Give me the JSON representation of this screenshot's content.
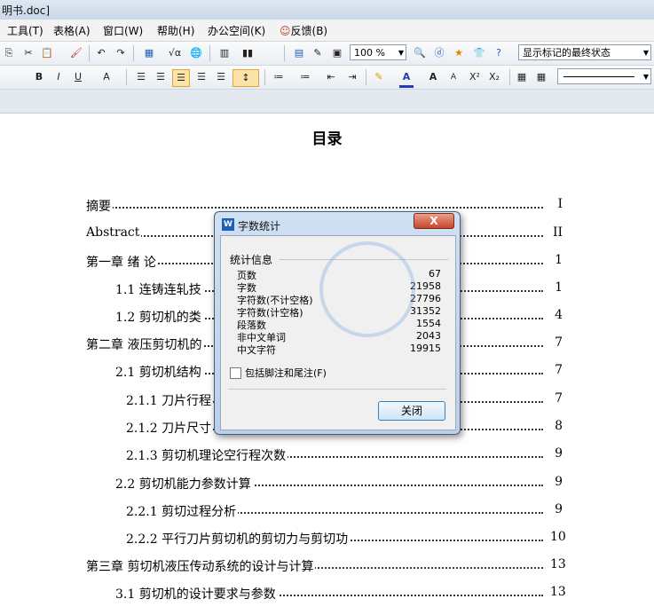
{
  "window": {
    "title": "明书.doc]"
  },
  "menu": [
    "工具(T)",
    "表格(A)",
    "窗口(W)",
    "帮助(H)",
    "办公空间(K)",
    "反馈(B)"
  ],
  "toolbar": {
    "zoom": "100 %",
    "markup_view": "显示标记的最终状态",
    "buttons": [
      "copy-icon",
      "cut-icon",
      "paste-icon",
      "format-painter-icon",
      "undo-icon",
      "redo-icon",
      "table-icon",
      "formula-icon",
      "hyperlink-icon",
      "columns-icon",
      "chart-icon",
      "word-count-icon",
      "drawing-icon",
      "document-map-icon",
      "zoom-icon",
      "find-icon",
      "research-icon",
      "favorites-icon",
      "shirt-icon",
      "help-icon"
    ],
    "format_buttons": [
      "B",
      "I",
      "U",
      "A",
      "左对齐",
      "居中",
      "右对齐",
      "两端对齐",
      "分散对齐",
      "行距",
      "编号",
      "项目符号",
      "减少缩进",
      "增加缩进",
      "高亮",
      "A",
      "A",
      "A",
      "X²",
      "X₂"
    ]
  },
  "document": {
    "title": "目录",
    "toc": [
      {
        "text": "摘要",
        "page": "I",
        "indent": 0
      },
      {
        "text": "Abstract",
        "page": "II",
        "indent": 0
      },
      {
        "text": "第一章  绪  论",
        "page": "1",
        "indent": 0
      },
      {
        "text": "1.1   连铸连轧技",
        "page": "1",
        "indent": 1
      },
      {
        "text": "1.2   剪切机的类",
        "page": "4",
        "indent": 1
      },
      {
        "text": "第二章  液压剪切机的",
        "page": "7",
        "indent": 0
      },
      {
        "text": "2.1  剪切机结构",
        "page": "7",
        "indent": 1
      },
      {
        "text": "2.1.1 刀片行程",
        "page": "7",
        "indent": 2
      },
      {
        "text": "2.1.2 刀片尺寸",
        "page": "8",
        "indent": 2
      },
      {
        "text": "2.1.3 剪切机理论空行程次数",
        "page": "9",
        "indent": 2
      },
      {
        "text": "2.2  剪切机能力参数计算",
        "page": "9",
        "indent": 1
      },
      {
        "text": "2.2.1 剪切过程分析",
        "page": "9",
        "indent": 2
      },
      {
        "text": "2.2.2 平行刀片剪切机的剪切力与剪切功",
        "page": "10",
        "indent": 2
      },
      {
        "text": "第三章  剪切机液压传动系统的设计与计算",
        "page": "13",
        "indent": 0
      },
      {
        "text": "3.1   剪切机的设计要求与参数",
        "page": "13",
        "indent": 1
      }
    ]
  },
  "dialog": {
    "title": "字数统计",
    "close_x": "X",
    "group_label": "统计信息",
    "stats": [
      {
        "label": "页数",
        "value": "67"
      },
      {
        "label": "字数",
        "value": "21958"
      },
      {
        "label": "字符数(不计空格)",
        "value": "27796"
      },
      {
        "label": "字符数(计空格)",
        "value": "31352"
      },
      {
        "label": "段落数",
        "value": "1554"
      },
      {
        "label": "非中文单词",
        "value": "2043"
      },
      {
        "label": "中文字符",
        "value": "19915"
      }
    ],
    "checkbox_label": "包括脚注和尾注(F)",
    "close_button": "关闭"
  }
}
